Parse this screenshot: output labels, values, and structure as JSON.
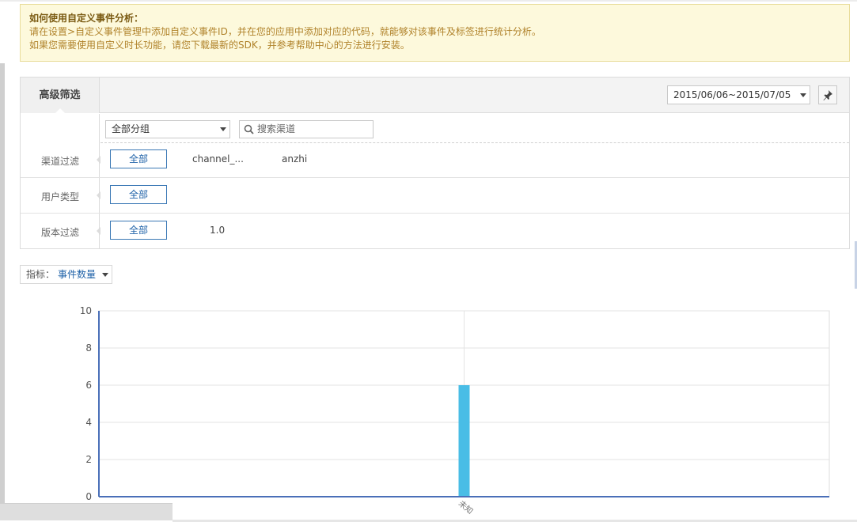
{
  "notice": {
    "title": "如何使用自定义事件分析：",
    "line1": "请在设置>自定义事件管理中添加自定义事件ID，并在您的应用中添加对应的代码，就能够对该事件及标签进行统计分析。",
    "line2": "如果您需要使用自定义时长功能，请您下载最新的SDK，并参考帮助中心的方法进行安装。"
  },
  "filter": {
    "tab_label": "高级筛选",
    "date_range": "2015/06/06~2015/07/05",
    "group_select": "全部分组",
    "search_placeholder": "搜索渠道",
    "rows": [
      {
        "label": "渠道过滤",
        "all": "全部",
        "options": [
          "channel_...",
          "anzhi"
        ]
      },
      {
        "label": "用户类型",
        "all": "全部",
        "options": []
      },
      {
        "label": "版本过滤",
        "all": "全部",
        "options": [
          "1.0"
        ]
      }
    ]
  },
  "metric": {
    "label": "指标：",
    "value": "事件数量"
  },
  "colors": {
    "bar": "#49bde6",
    "axis": "#4a6fb8",
    "link": "#1f62a8",
    "notice_bg": "#fdf9dc"
  },
  "chart_data": {
    "type": "bar",
    "categories": [
      "未知"
    ],
    "values": [
      6
    ],
    "ylim": [
      0,
      10
    ],
    "yticks": [
      0,
      2,
      4,
      6,
      8,
      10
    ],
    "grid": true
  }
}
